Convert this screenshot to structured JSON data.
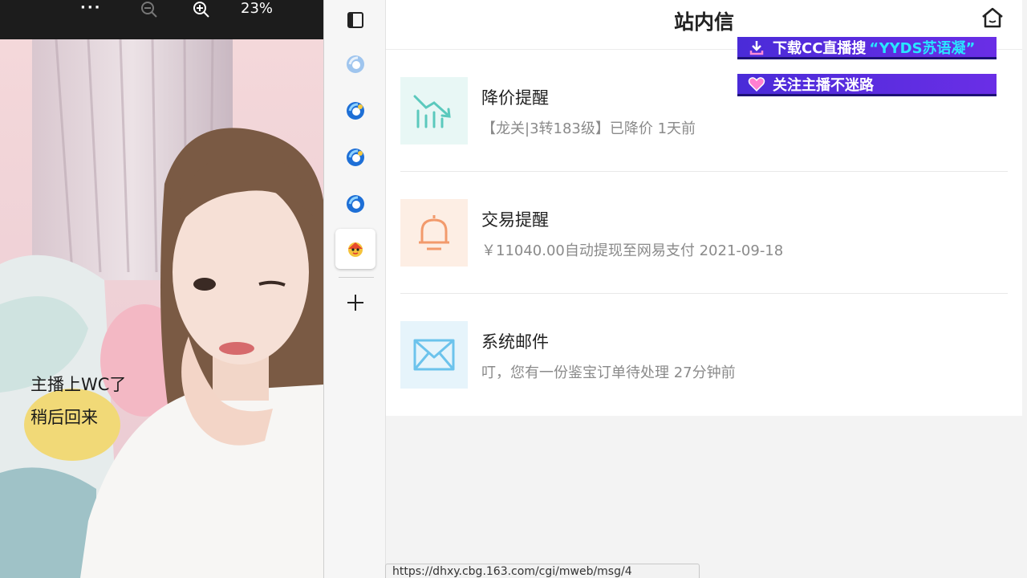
{
  "viewer": {
    "more_label": "···",
    "zoom_percent": "23%",
    "overlay_line1": "主播上WC了",
    "overlay_line2": "稍后回来"
  },
  "header": {
    "title": "站内信"
  },
  "messages": [
    {
      "title": "降价提醒",
      "desc": "【龙关|3转183级】已降价 1天前",
      "icon": "price-drop-chart-icon",
      "color": "#5bc9bd",
      "bg": "#e8f7f5"
    },
    {
      "title": "交易提醒",
      "desc": "￥11040.00自动提现至网易支付 2021-09-18",
      "icon": "bell-icon",
      "color": "#f29a6c",
      "bg": "#fdeee4"
    },
    {
      "title": "系统邮件",
      "desc": "叮，您有一份鉴宝订单待处理 27分钟前",
      "icon": "mail-envelope-icon",
      "color": "#6cc3ec",
      "bg": "#e6f4fb"
    }
  ],
  "banners": {
    "download_prefix": "下载CC直播搜",
    "download_highlight": "“YYDS苏语凝”",
    "follow": "关注主播不迷路"
  },
  "status": {
    "url": "https://dhxy.cbg.163.com/cgi/mweb/msg/4"
  },
  "colors": {
    "banner": "#5a2de0",
    "banner_highlight": "#29e6ff",
    "tab_icon_blue": "#1e6fd6"
  }
}
